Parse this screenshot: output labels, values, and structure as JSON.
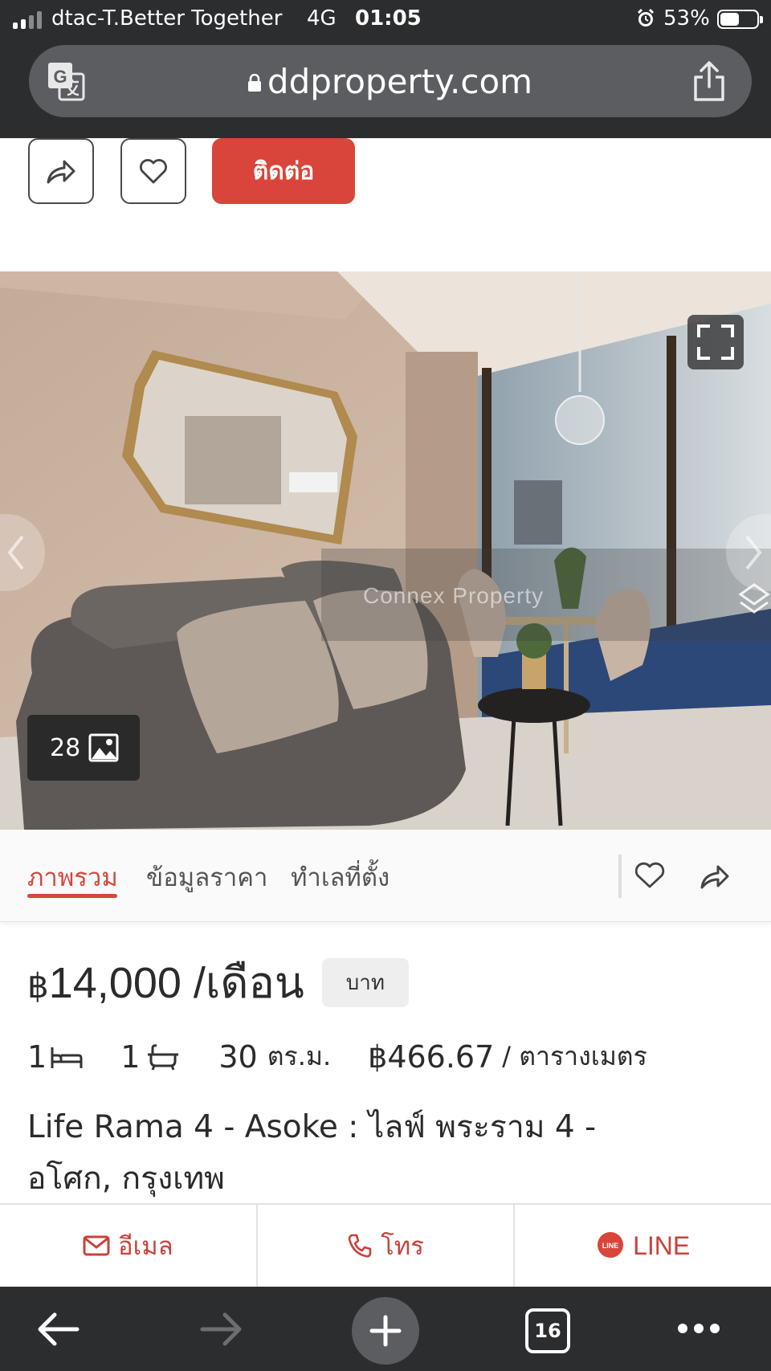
{
  "status_bar": {
    "carrier": "dtac-T.Better Together",
    "network": "4G",
    "time": "01:05",
    "battery_percent_label": "53%",
    "battery_level": 0.53
  },
  "browser": {
    "url": "ddproperty.com",
    "tab_count": "16"
  },
  "actions": {
    "contact_label": "ติดต่อ"
  },
  "photo": {
    "count": "28",
    "watermark": "Connex Property"
  },
  "tabs": [
    {
      "label": "ภาพรวม",
      "active": true
    },
    {
      "label": "ข้อมูลราคา",
      "active": false
    },
    {
      "label": "ทำเลที่ตั้ง",
      "active": false
    }
  ],
  "listing": {
    "currency_symbol": "฿",
    "price": "14,000",
    "price_period": "/เดือน",
    "currency_chip": "บาท",
    "bedrooms": "1",
    "bathrooms": "1",
    "area_value": "30",
    "area_unit": "ตร.ม.",
    "price_per_sqm": "฿466.67",
    "price_per_sqm_unit": "/ ตารางเมตร",
    "title_line1": "Life Rama 4 - Asoke : ไลฟ์ พระราม 4 -",
    "title_line2": "อโศก, กรุงเทพ"
  },
  "contact_bar": {
    "email_label": "อีเมล",
    "phone_label": "โทร",
    "line_label": "LINE",
    "line_badge": "LINE"
  },
  "colors": {
    "accent": "#d9453a",
    "browser_chrome": "#2c2d2f"
  }
}
